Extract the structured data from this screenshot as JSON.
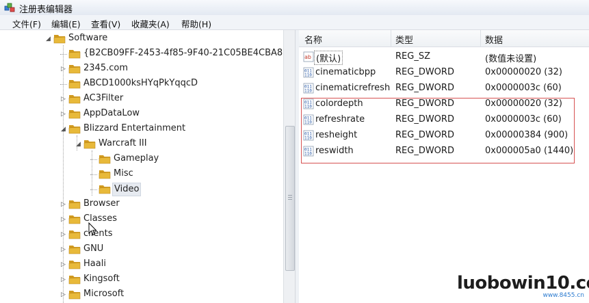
{
  "window": {
    "title": "注册表编辑器"
  },
  "menu": {
    "items": [
      "文件(F)",
      "编辑(E)",
      "查看(V)",
      "收藏夹(A)",
      "帮助(H)"
    ]
  },
  "tree": {
    "items": [
      {
        "label": "Software",
        "expander": "expanded"
      },
      {
        "label": "{B2CB09FF-2453-4f85-9F40-21C05BE4CBA8}",
        "expander": "none"
      },
      {
        "label": "2345.com",
        "expander": "collapsed"
      },
      {
        "label": "ABCD1000ksHYqPkYqqcD",
        "expander": "none"
      },
      {
        "label": "AC3Filter",
        "expander": "collapsed"
      },
      {
        "label": "AppDataLow",
        "expander": "collapsed"
      },
      {
        "label": "Blizzard Entertainment",
        "expander": "expanded"
      },
      {
        "label": "Warcraft III",
        "expander": "expanded"
      },
      {
        "label": "Gameplay",
        "expander": "none"
      },
      {
        "label": "Misc",
        "expander": "none"
      },
      {
        "label": "Video",
        "expander": "none",
        "selected": true
      },
      {
        "label": "Browser",
        "expander": "collapsed"
      },
      {
        "label": "Classes",
        "expander": "collapsed"
      },
      {
        "label": "clients",
        "expander": "collapsed"
      },
      {
        "label": "GNU",
        "expander": "collapsed"
      },
      {
        "label": "Haali",
        "expander": "collapsed"
      },
      {
        "label": "Kingsoft",
        "expander": "collapsed"
      },
      {
        "label": "Microsoft",
        "expander": "collapsed"
      }
    ]
  },
  "list": {
    "columns": [
      "名称",
      "类型",
      "数据"
    ],
    "rows": [
      {
        "name": "(默认)",
        "type": "REG_SZ",
        "data": "(数值未设置)",
        "icon": "string-value-icon"
      },
      {
        "name": "cinematicbpp",
        "type": "REG_DWORD",
        "data": "0x00000020 (32)",
        "icon": "dword-value-icon"
      },
      {
        "name": "cinematicrefresh",
        "type": "REG_DWORD",
        "data": "0x0000003c (60)",
        "icon": "dword-value-icon"
      },
      {
        "name": "colordepth",
        "type": "REG_DWORD",
        "data": "0x00000020 (32)",
        "icon": "dword-value-icon"
      },
      {
        "name": "refreshrate",
        "type": "REG_DWORD",
        "data": "0x0000003c (60)",
        "icon": "dword-value-icon"
      },
      {
        "name": "resheight",
        "type": "REG_DWORD",
        "data": "0x00000384 (900)",
        "icon": "dword-value-icon"
      },
      {
        "name": "reswidth",
        "type": "REG_DWORD",
        "data": "0x000005a0 (1440)",
        "icon": "dword-value-icon"
      }
    ]
  },
  "watermark": {
    "text": "luobowin10.com",
    "sub": "www.8455.cn"
  },
  "colors": {
    "highlight": "#d65050",
    "folder": "#e8b93a"
  }
}
